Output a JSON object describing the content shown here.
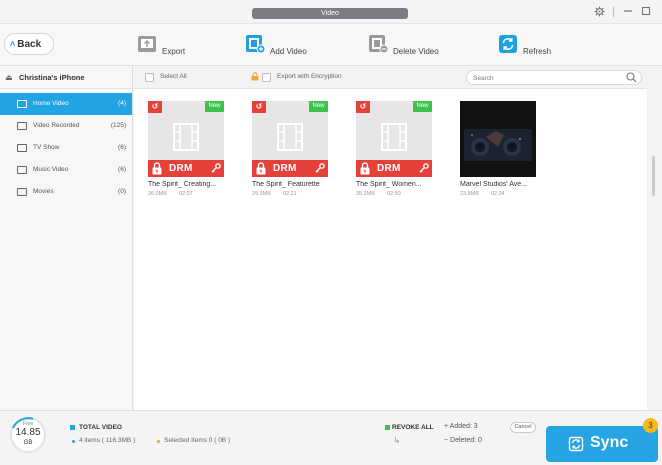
{
  "window": {
    "title": "Video"
  },
  "toolbar": {
    "back_label": "Back",
    "export_label": "Export",
    "add_video_label": "Add Video",
    "delete_video_label": "Delete Video",
    "refresh_label": "Refresh"
  },
  "sidebar": {
    "device_name": "Christina's iPhone",
    "items": [
      {
        "label": "Home Video",
        "count": "(4)"
      },
      {
        "label": "Video Recorded",
        "count": "(125)"
      },
      {
        "label": "TV Show",
        "count": "(6)"
      },
      {
        "label": "Music Video",
        "count": "(6)"
      },
      {
        "label": "Movies",
        "count": "(0)"
      }
    ]
  },
  "subbar": {
    "select_all_label": "Select All",
    "export_encryption_label": "Export with Encryption",
    "search_placeholder": "Search"
  },
  "videos": [
    {
      "name": "The Spirit_ Creating...",
      "size": "26.0MB",
      "duration": "02:07",
      "revoke_tag": "↺",
      "new_tag": "New",
      "drm_label": "DRM"
    },
    {
      "name": "The Spirit_ Featurette",
      "size": "29.3MB",
      "duration": "02:21",
      "revoke_tag": "↺",
      "new_tag": "New",
      "drm_label": "DRM"
    },
    {
      "name": "The Spirit_ Women...",
      "size": "35.2MB",
      "duration": "02:50",
      "revoke_tag": "↺",
      "new_tag": "New",
      "drm_label": "DRM"
    },
    {
      "name": "Marvel Studios' Ave...",
      "size": "23.8MB",
      "duration": "02:24"
    }
  ],
  "footer": {
    "storage_free_label": "Free",
    "storage_value": "14.85",
    "storage_unit": "GB",
    "total_title": "TOTAL VIDEO",
    "items_summary": "4 items ( 116.3MB )",
    "selected_summary": "Selected Items 0 ( 0B )",
    "revoke_all_label": "REVOKE ALL",
    "added_label": "+ Added: 3",
    "deleted_label": "− Deleted: 0",
    "cancel_label": "Cancel",
    "sync_label": "Sync",
    "badge_count": "3"
  },
  "colors": {
    "accent": "#22a3e3",
    "drm_red": "#e5413b",
    "new_green": "#3cc24d",
    "badge_yellow": "#f6b81b",
    "items_dot_blue": "#2aa3e3",
    "selected_dot_orange": "#f3a43a"
  },
  "icons": {
    "export": "export-icon",
    "add_video": "add-video-icon",
    "delete_video": "delete-video-icon",
    "refresh": "refresh-icon",
    "search": "search-icon",
    "settings": "gear-icon",
    "minimize": "minimize-icon",
    "maximize": "maximize-icon",
    "eject": "eject-icon",
    "lock": "lock-icon",
    "sync": "sync-icon"
  }
}
